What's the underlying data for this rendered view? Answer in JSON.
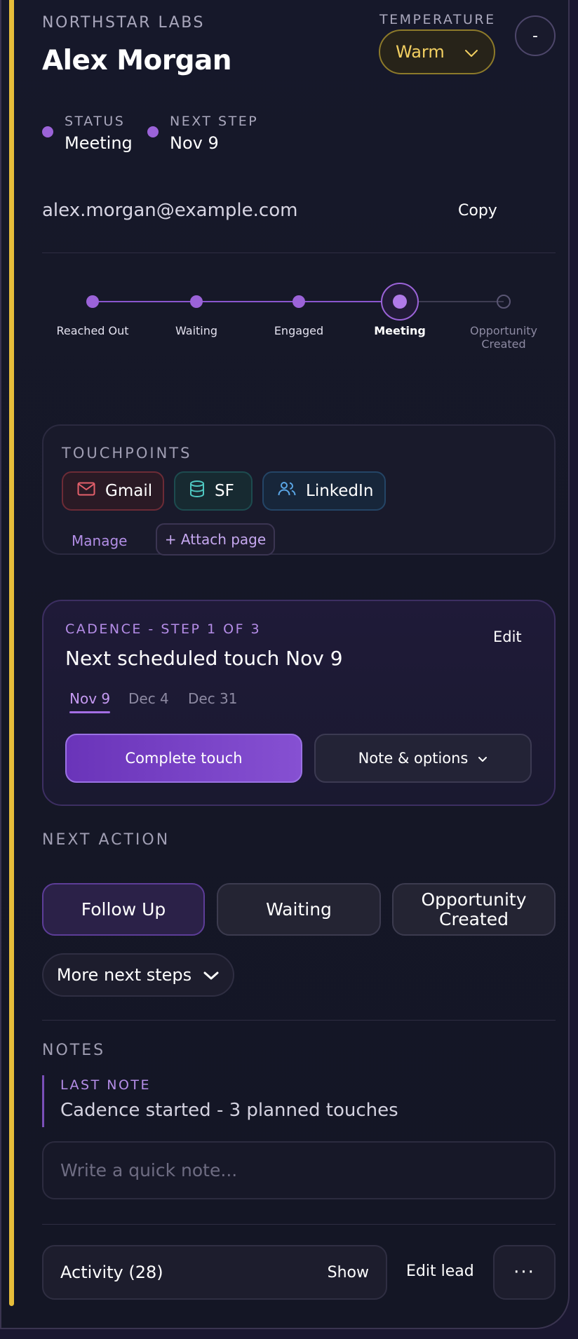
{
  "header": {
    "company": "NORTHSTAR LABS",
    "name": "Alex Morgan",
    "temperature_label": "TEMPERATURE",
    "temperature_value": "Warm",
    "collapse_label": "-"
  },
  "meta": {
    "status_label": "STATUS",
    "status_value": "Meeting",
    "next_step_label": "NEXT STEP",
    "next_step_value": "Nov 9"
  },
  "contact": {
    "email": "alex.morgan@example.com",
    "copy_label": "Copy"
  },
  "stages": [
    {
      "label": "Reached Out",
      "state": "done"
    },
    {
      "label": "Waiting",
      "state": "done"
    },
    {
      "label": "Engaged",
      "state": "done"
    },
    {
      "label": "Meeting",
      "state": "active"
    },
    {
      "label": "Opportunity Created",
      "state": "future"
    }
  ],
  "touchpoints": {
    "title": "TOUCHPOINTS",
    "items": [
      {
        "label": "Gmail",
        "icon": "mail-icon",
        "color": "#e4606b"
      },
      {
        "label": "SF",
        "icon": "database-icon",
        "color": "#4fc8c2"
      },
      {
        "label": "LinkedIn",
        "icon": "users-icon",
        "color": "#5aa6e6"
      }
    ],
    "manage_label": "Manage",
    "attach_label": "+ Attach page"
  },
  "cadence": {
    "label": "CADENCE - STEP 1 OF 3",
    "title": "Next scheduled touch Nov 9",
    "edit_label": "Edit",
    "dates": [
      "Nov 9",
      "Dec 4",
      "Dec 31"
    ],
    "complete_label": "Complete touch",
    "note_options_label": "Note & options"
  },
  "next_action": {
    "title": "NEXT ACTION",
    "buttons": [
      "Follow Up",
      "Waiting",
      "Opportunity Created"
    ],
    "more_label": "More next steps"
  },
  "notes": {
    "title": "NOTES",
    "last_note_label": "LAST NOTE",
    "last_note": "Cadence started - 3 planned touches",
    "placeholder": "Write a quick note..."
  },
  "footer": {
    "activity_label": "Activity (28)",
    "show_label": "Show",
    "edit_lead_label": "Edit lead",
    "more_label": "···"
  },
  "colors": {
    "accent_bar": "#e6bd3a",
    "primary": "#8650d2",
    "warm": "#f2cf61"
  }
}
